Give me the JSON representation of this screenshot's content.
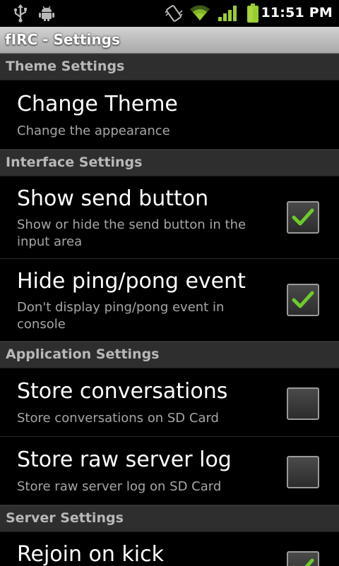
{
  "status_bar": {
    "time": "11:51 PM",
    "icons": [
      "usb-icon",
      "android-debug-icon",
      "vibrate-icon",
      "wifi-icon",
      "signal-icon",
      "battery-icon"
    ]
  },
  "app": {
    "title": "fIRC - Settings"
  },
  "colors": {
    "check_mark": "#6ecb2b",
    "category_background": "#2e2e2e",
    "summary_text": "#a6a6a6",
    "status_green": "#9acd32"
  },
  "settings": {
    "theme": {
      "header": "Theme Settings",
      "change_theme": {
        "title": "Change Theme",
        "summary": "Change the appearance"
      }
    },
    "interface": {
      "header": "Interface Settings",
      "show_send_button": {
        "title": "Show send button",
        "summary": "Show or hide the send button in the input area",
        "checked": true
      },
      "hide_ping_pong": {
        "title": "Hide ping/pong event",
        "summary": "Don't display ping/pong event in console",
        "checked": true
      }
    },
    "application": {
      "header": "Application Settings",
      "store_conversations": {
        "title": "Store conversations",
        "summary": "Store conversations on SD Card",
        "checked": false
      },
      "store_raw_log": {
        "title": "Store raw server log",
        "summary": "Store raw server log on SD Card",
        "checked": false
      }
    },
    "server": {
      "header": "Server Settings",
      "rejoin_on_kick": {
        "title": "Rejoin on kick",
        "checked": true
      }
    }
  }
}
